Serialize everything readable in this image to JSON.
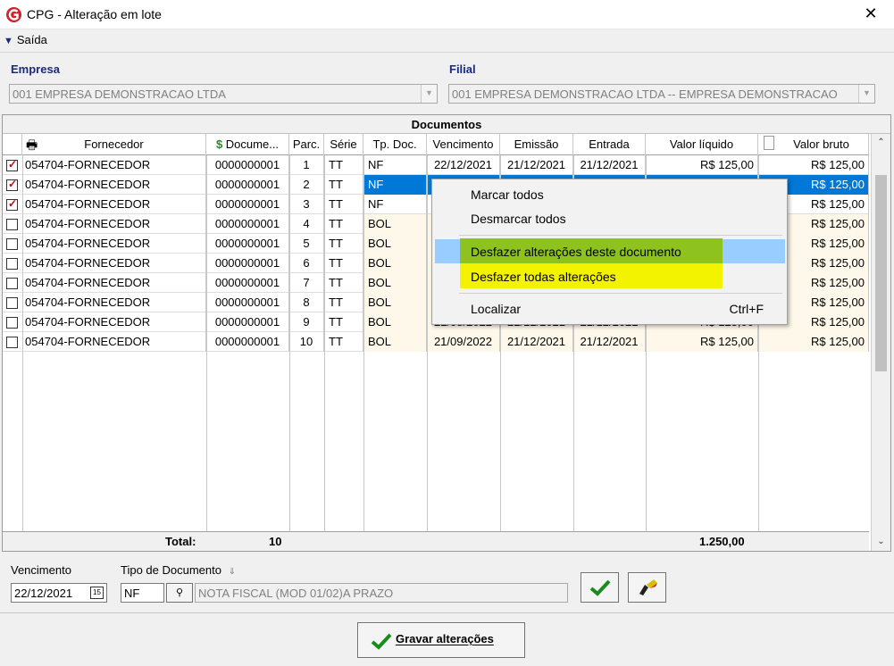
{
  "window": {
    "title": "CPG - Alteração em lote",
    "close_glyph": "✕"
  },
  "menu": {
    "exit_label": "Saída"
  },
  "empresa": {
    "label": "Empresa",
    "value": "001 EMPRESA DEMONSTRACAO LTDA"
  },
  "filial": {
    "label": "Filial",
    "value": "001 EMPRESA DEMONSTRACAO LTDA -- EMPRESA DEMONSTRACAO"
  },
  "grid": {
    "title": "Documentos",
    "columns": [
      "Fornecedor",
      "Docume...",
      "Parc.",
      "Série",
      "Tp. Doc.",
      "Vencimento",
      "Emissão",
      "Entrada",
      "Valor líquido",
      "Valor bruto"
    ],
    "rows": [
      {
        "checked": true,
        "fornecedor": "054704-FORNECEDOR",
        "documento": "0000000001",
        "parc": "1",
        "serie": "TT",
        "tpdoc": "NF",
        "vencimento": "22/12/2021",
        "emissao": "21/12/2021",
        "entrada": "21/12/2021",
        "liquido": "R$ 125,00",
        "bruto": "R$ 125,00"
      },
      {
        "checked": true,
        "fornecedor": "054704-FORNECEDOR",
        "documento": "0000000001",
        "parc": "2",
        "serie": "TT",
        "tpdoc": "NF",
        "vencimento": "",
        "emissao": "",
        "entrada": "",
        "liquido": "",
        "bruto": "R$ 125,00"
      },
      {
        "checked": true,
        "fornecedor": "054704-FORNECEDOR",
        "documento": "0000000001",
        "parc": "3",
        "serie": "TT",
        "tpdoc": "NF",
        "vencimento": "",
        "emissao": "",
        "entrada": "",
        "liquido": "",
        "bruto": "R$ 125,00"
      },
      {
        "checked": false,
        "fornecedor": "054704-FORNECEDOR",
        "documento": "0000000001",
        "parc": "4",
        "serie": "TT",
        "tpdoc": "BOL",
        "vencimento": "",
        "emissao": "",
        "entrada": "",
        "liquido": "",
        "bruto": "R$ 125,00"
      },
      {
        "checked": false,
        "fornecedor": "054704-FORNECEDOR",
        "documento": "0000000001",
        "parc": "5",
        "serie": "TT",
        "tpdoc": "BOL",
        "vencimento": "",
        "emissao": "",
        "entrada": "",
        "liquido": "",
        "bruto": "R$ 125,00"
      },
      {
        "checked": false,
        "fornecedor": "054704-FORNECEDOR",
        "documento": "0000000001",
        "parc": "6",
        "serie": "TT",
        "tpdoc": "BOL",
        "vencimento": "",
        "emissao": "",
        "entrada": "",
        "liquido": "",
        "bruto": "R$ 125,00"
      },
      {
        "checked": false,
        "fornecedor": "054704-FORNECEDOR",
        "documento": "0000000001",
        "parc": "7",
        "serie": "TT",
        "tpdoc": "BOL",
        "vencimento": "",
        "emissao": "",
        "entrada": "",
        "liquido": "",
        "bruto": "R$ 125,00"
      },
      {
        "checked": false,
        "fornecedor": "054704-FORNECEDOR",
        "documento": "0000000001",
        "parc": "8",
        "serie": "TT",
        "tpdoc": "BOL",
        "vencimento": "",
        "emissao": "",
        "entrada": "",
        "liquido": "",
        "bruto": "R$ 125,00"
      },
      {
        "checked": false,
        "fornecedor": "054704-FORNECEDOR",
        "documento": "0000000001",
        "parc": "9",
        "serie": "TT",
        "tpdoc": "BOL",
        "vencimento": "21/08/2022",
        "emissao": "21/12/2021",
        "entrada": "21/12/2021",
        "liquido": "R$ 125,00",
        "bruto": "R$ 125,00"
      },
      {
        "checked": false,
        "fornecedor": "054704-FORNECEDOR",
        "documento": "0000000001",
        "parc": "10",
        "serie": "TT",
        "tpdoc": "BOL",
        "vencimento": "21/09/2022",
        "emissao": "21/12/2021",
        "entrada": "21/12/2021",
        "liquido": "R$ 125,00",
        "bruto": "R$ 125,00"
      }
    ],
    "total_label": "Total:",
    "total_count": "10",
    "total_value": "1.250,00"
  },
  "context_menu": {
    "items": [
      "Marcar todos",
      "Desmarcar todos",
      "Desfazer alterações deste documento",
      "Desfazer todas alterações",
      "Localizar"
    ],
    "shortcut": "Ctrl+F"
  },
  "footer": {
    "vencimento_label": "Vencimento",
    "vencimento_value": "22/12/2021",
    "tipo_label": "Tipo de Documento",
    "tipo_code": "NF",
    "tipo_desc": "NOTA FISCAL (MOD 01/02)A PRAZO",
    "save_label": "Gravar alterações"
  },
  "colors": {
    "accent_blue": "#1a2a80",
    "selection": "#0078d7",
    "highlight_green": "#8dc21f",
    "highlight_yellow": "#f3f300",
    "check_red": "#d00000"
  }
}
